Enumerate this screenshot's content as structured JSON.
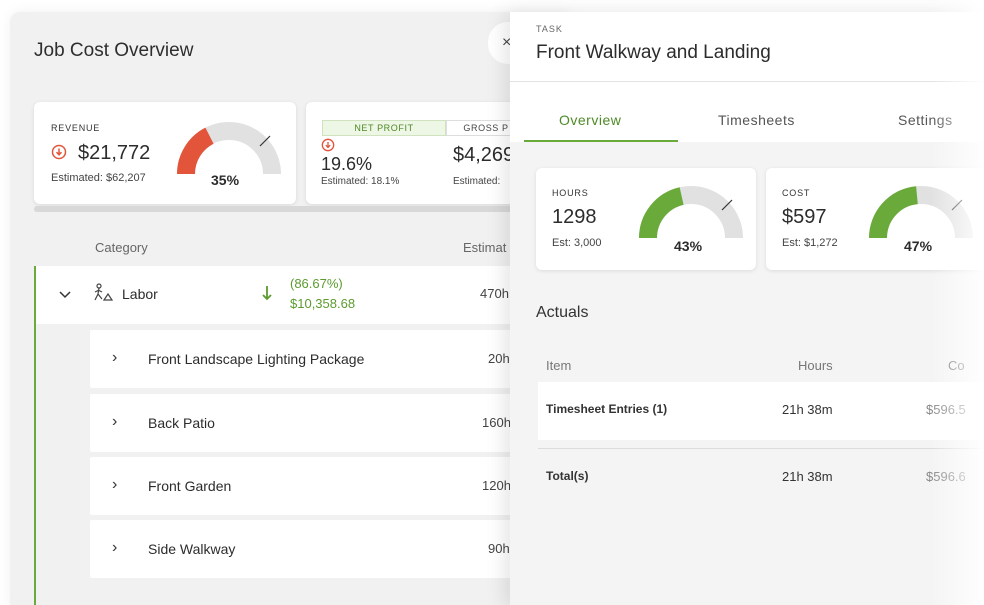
{
  "job": {
    "title": "Job Cost Overview",
    "revenue": {
      "label": "REVENUE",
      "value": "$21,772",
      "estimated": "Estimated: $62,207",
      "percent_text": "35%",
      "percent": 0.35,
      "color": "#e2553b"
    },
    "profit": {
      "tab_net": "NET PROFIT",
      "tab_gross": "GROSS P",
      "net_value": "19.6%",
      "net_estimated": "Estimated: 18.1%",
      "gross_value": "$4,269",
      "gross_estimated": "Estimated:"
    },
    "table": {
      "col_category": "Category",
      "col_estimated": "Estimat",
      "labor": {
        "label": "Labor",
        "variance_pct": "(86.67%)",
        "variance_amt": "$10,358.68",
        "estimated": "470h"
      },
      "rows": [
        {
          "label": "Front Landscape Lighting Package",
          "value": "20h"
        },
        {
          "label": "Back Patio",
          "value": "160h"
        },
        {
          "label": "Front Garden",
          "value": "120h"
        },
        {
          "label": "Side Walkway",
          "value": "90h"
        }
      ]
    }
  },
  "panel": {
    "task_label": "TASK",
    "task_title": "Front Walkway and Landing",
    "close_icon": "×",
    "tabs": [
      {
        "label": "Overview",
        "active": true
      },
      {
        "label": "Timesheets",
        "active": false
      },
      {
        "label": "Settings",
        "active": false
      }
    ],
    "hours": {
      "label": "HOURS",
      "value": "1298",
      "estimated": "Est: 3,000",
      "percent_text": "43%",
      "percent": 0.43
    },
    "cost": {
      "label": "COST",
      "value": "$597",
      "estimated": "Est:  $1,272",
      "percent_text": "47%",
      "percent": 0.47
    },
    "actuals": {
      "title": "Actuals",
      "headers": {
        "item": "Item",
        "hours": "Hours",
        "cost": "Co"
      },
      "rows": [
        {
          "item": "Timesheet Entries (1)",
          "hours": "21h 38m",
          "cost": "$596.5"
        }
      ],
      "total": {
        "item": "Total(s)",
        "hours": "21h 38m",
        "cost": "$596.6"
      }
    }
  },
  "colors": {
    "accent_green": "#6aaa3a",
    "alert_red": "#e2553b",
    "gauge_track": "#e1e1e1"
  }
}
